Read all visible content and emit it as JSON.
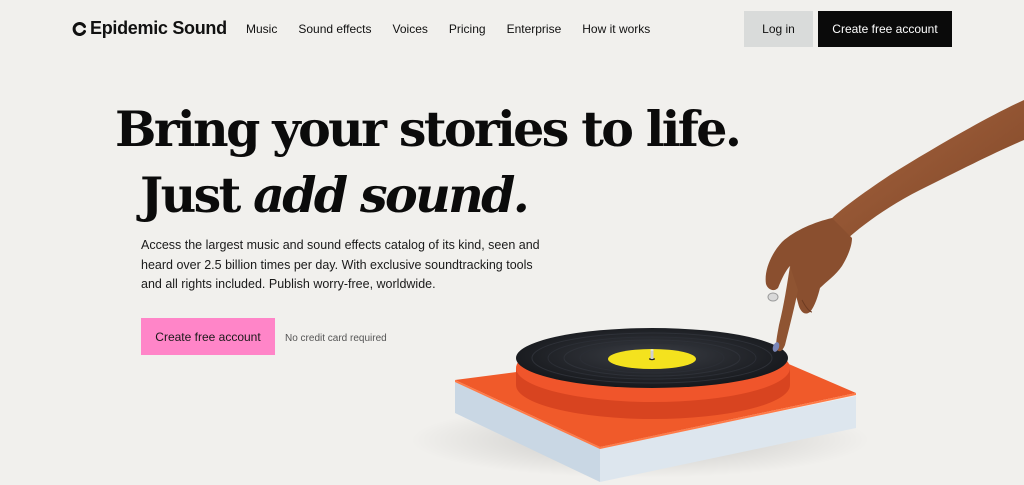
{
  "header": {
    "logo_text": "Epidemic Sound",
    "nav": [
      "Music",
      "Sound effects",
      "Voices",
      "Pricing",
      "Enterprise",
      "How it works"
    ],
    "login_label": "Log in",
    "create_account_label": "Create free account"
  },
  "hero": {
    "headline_line1": "Bring your stories to life.",
    "headline_line2_prefix": "Just ",
    "headline_line2_emphasis": "add sound.",
    "subtext": "Access the largest music and sound effects catalog of its kind, seen and heard over 2.5 billion times per day. With exclusive soundtracking tools and all rights included. Publish worry-free, worldwide.",
    "cta_label": "Create free account",
    "cta_note": "No credit card required"
  },
  "colors": {
    "background": "#f1f0ed",
    "primary_button": "#0a0a0a",
    "cta_pink": "#ff85c8",
    "login_button": "#d9dbda",
    "turntable_orange": "#f05a2a",
    "record_label_yellow": "#f4e21e"
  },
  "icons": {
    "logo": "epidemic-sound-logo-icon"
  }
}
